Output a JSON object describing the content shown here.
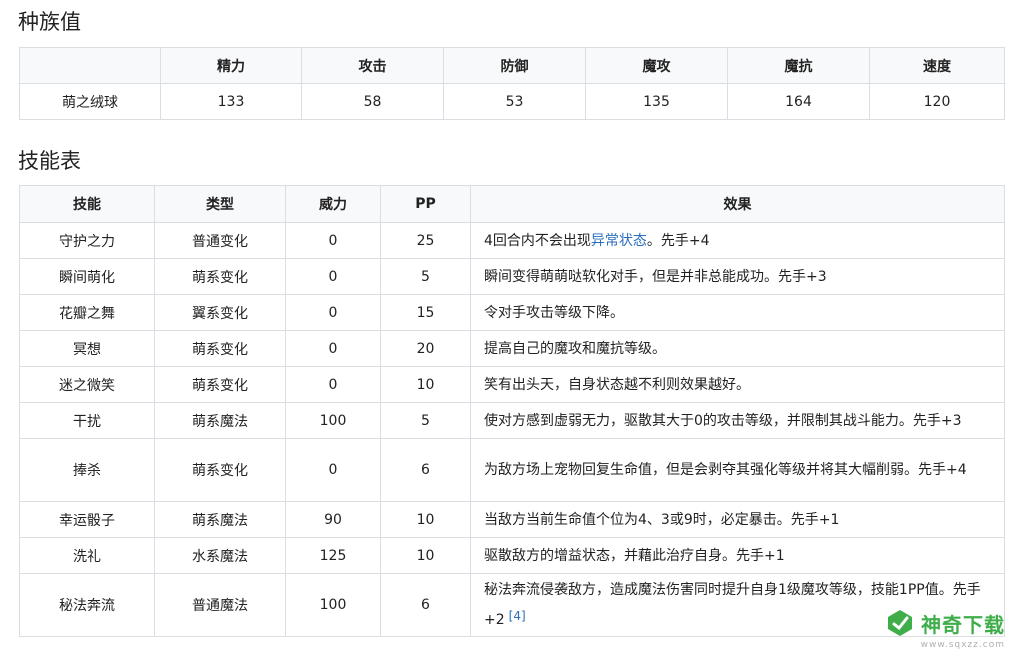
{
  "sections": {
    "stats_title": "种族值",
    "skills_title": "技能表"
  },
  "stats": {
    "headers": [
      "",
      "精力",
      "攻击",
      "防御",
      "魔攻",
      "魔抗",
      "速度"
    ],
    "row": [
      "萌之绒球",
      "133",
      "58",
      "53",
      "135",
      "164",
      "120"
    ]
  },
  "skills": {
    "headers": [
      "技能",
      "类型",
      "威力",
      "PP",
      "效果"
    ],
    "rows": [
      {
        "name": "守护之力",
        "type": "普通变化",
        "power": "0",
        "pp": "25",
        "effect_pre": "4回合内不会出现",
        "effect_link": "异常状态",
        "effect_post": "。先手+4"
      },
      {
        "name": "瞬间萌化",
        "type": "萌系变化",
        "power": "0",
        "pp": "5",
        "effect": "瞬间变得萌萌哒软化对手，但是并非总能成功。先手+3"
      },
      {
        "name": "花瓣之舞",
        "type": "翼系变化",
        "power": "0",
        "pp": "15",
        "effect": "令对手攻击等级下降。"
      },
      {
        "name": "冥想",
        "type": "萌系变化",
        "power": "0",
        "pp": "20",
        "effect": "提高自己的魔攻和魔抗等级。"
      },
      {
        "name": "迷之微笑",
        "type": "萌系变化",
        "power": "0",
        "pp": "10",
        "effect": "笑有出头天，自身状态越不利则效果越好。"
      },
      {
        "name": "干扰",
        "type": "萌系魔法",
        "power": "100",
        "pp": "5",
        "effect": "使对方感到虚弱无力，驱散其大于0的攻击等级，并限制其战斗能力。先手+3"
      },
      {
        "name": "捧杀",
        "type": "萌系变化",
        "power": "0",
        "pp": "6",
        "effect": "为敌方场上宠物回复生命值，但是会剥夺其强化等级并将其大幅削弱。先手+4"
      },
      {
        "name": "幸运骰子",
        "type": "萌系魔法",
        "power": "90",
        "pp": "10",
        "effect": "当敌方当前生命值个位为4、3或9时，必定暴击。先手+1"
      },
      {
        "name": "洗礼",
        "type": "水系魔法",
        "power": "125",
        "pp": "10",
        "effect": "驱散敌方的增益状态，并藉此治疗自身。先手+1"
      },
      {
        "name": "秘法奔流",
        "type": "普通魔法",
        "power": "100",
        "pp": "6",
        "effect": "秘法奔流侵袭敌方，造成魔法伤害同时提升自身1级魔攻等级，技能1PP值。先手+2",
        "ref": "[4]"
      }
    ]
  },
  "watermark": {
    "text": "神奇下载",
    "url": "www.sqxzz.com",
    "icon": "leaf-logo-icon",
    "color": "#3fae4a"
  }
}
